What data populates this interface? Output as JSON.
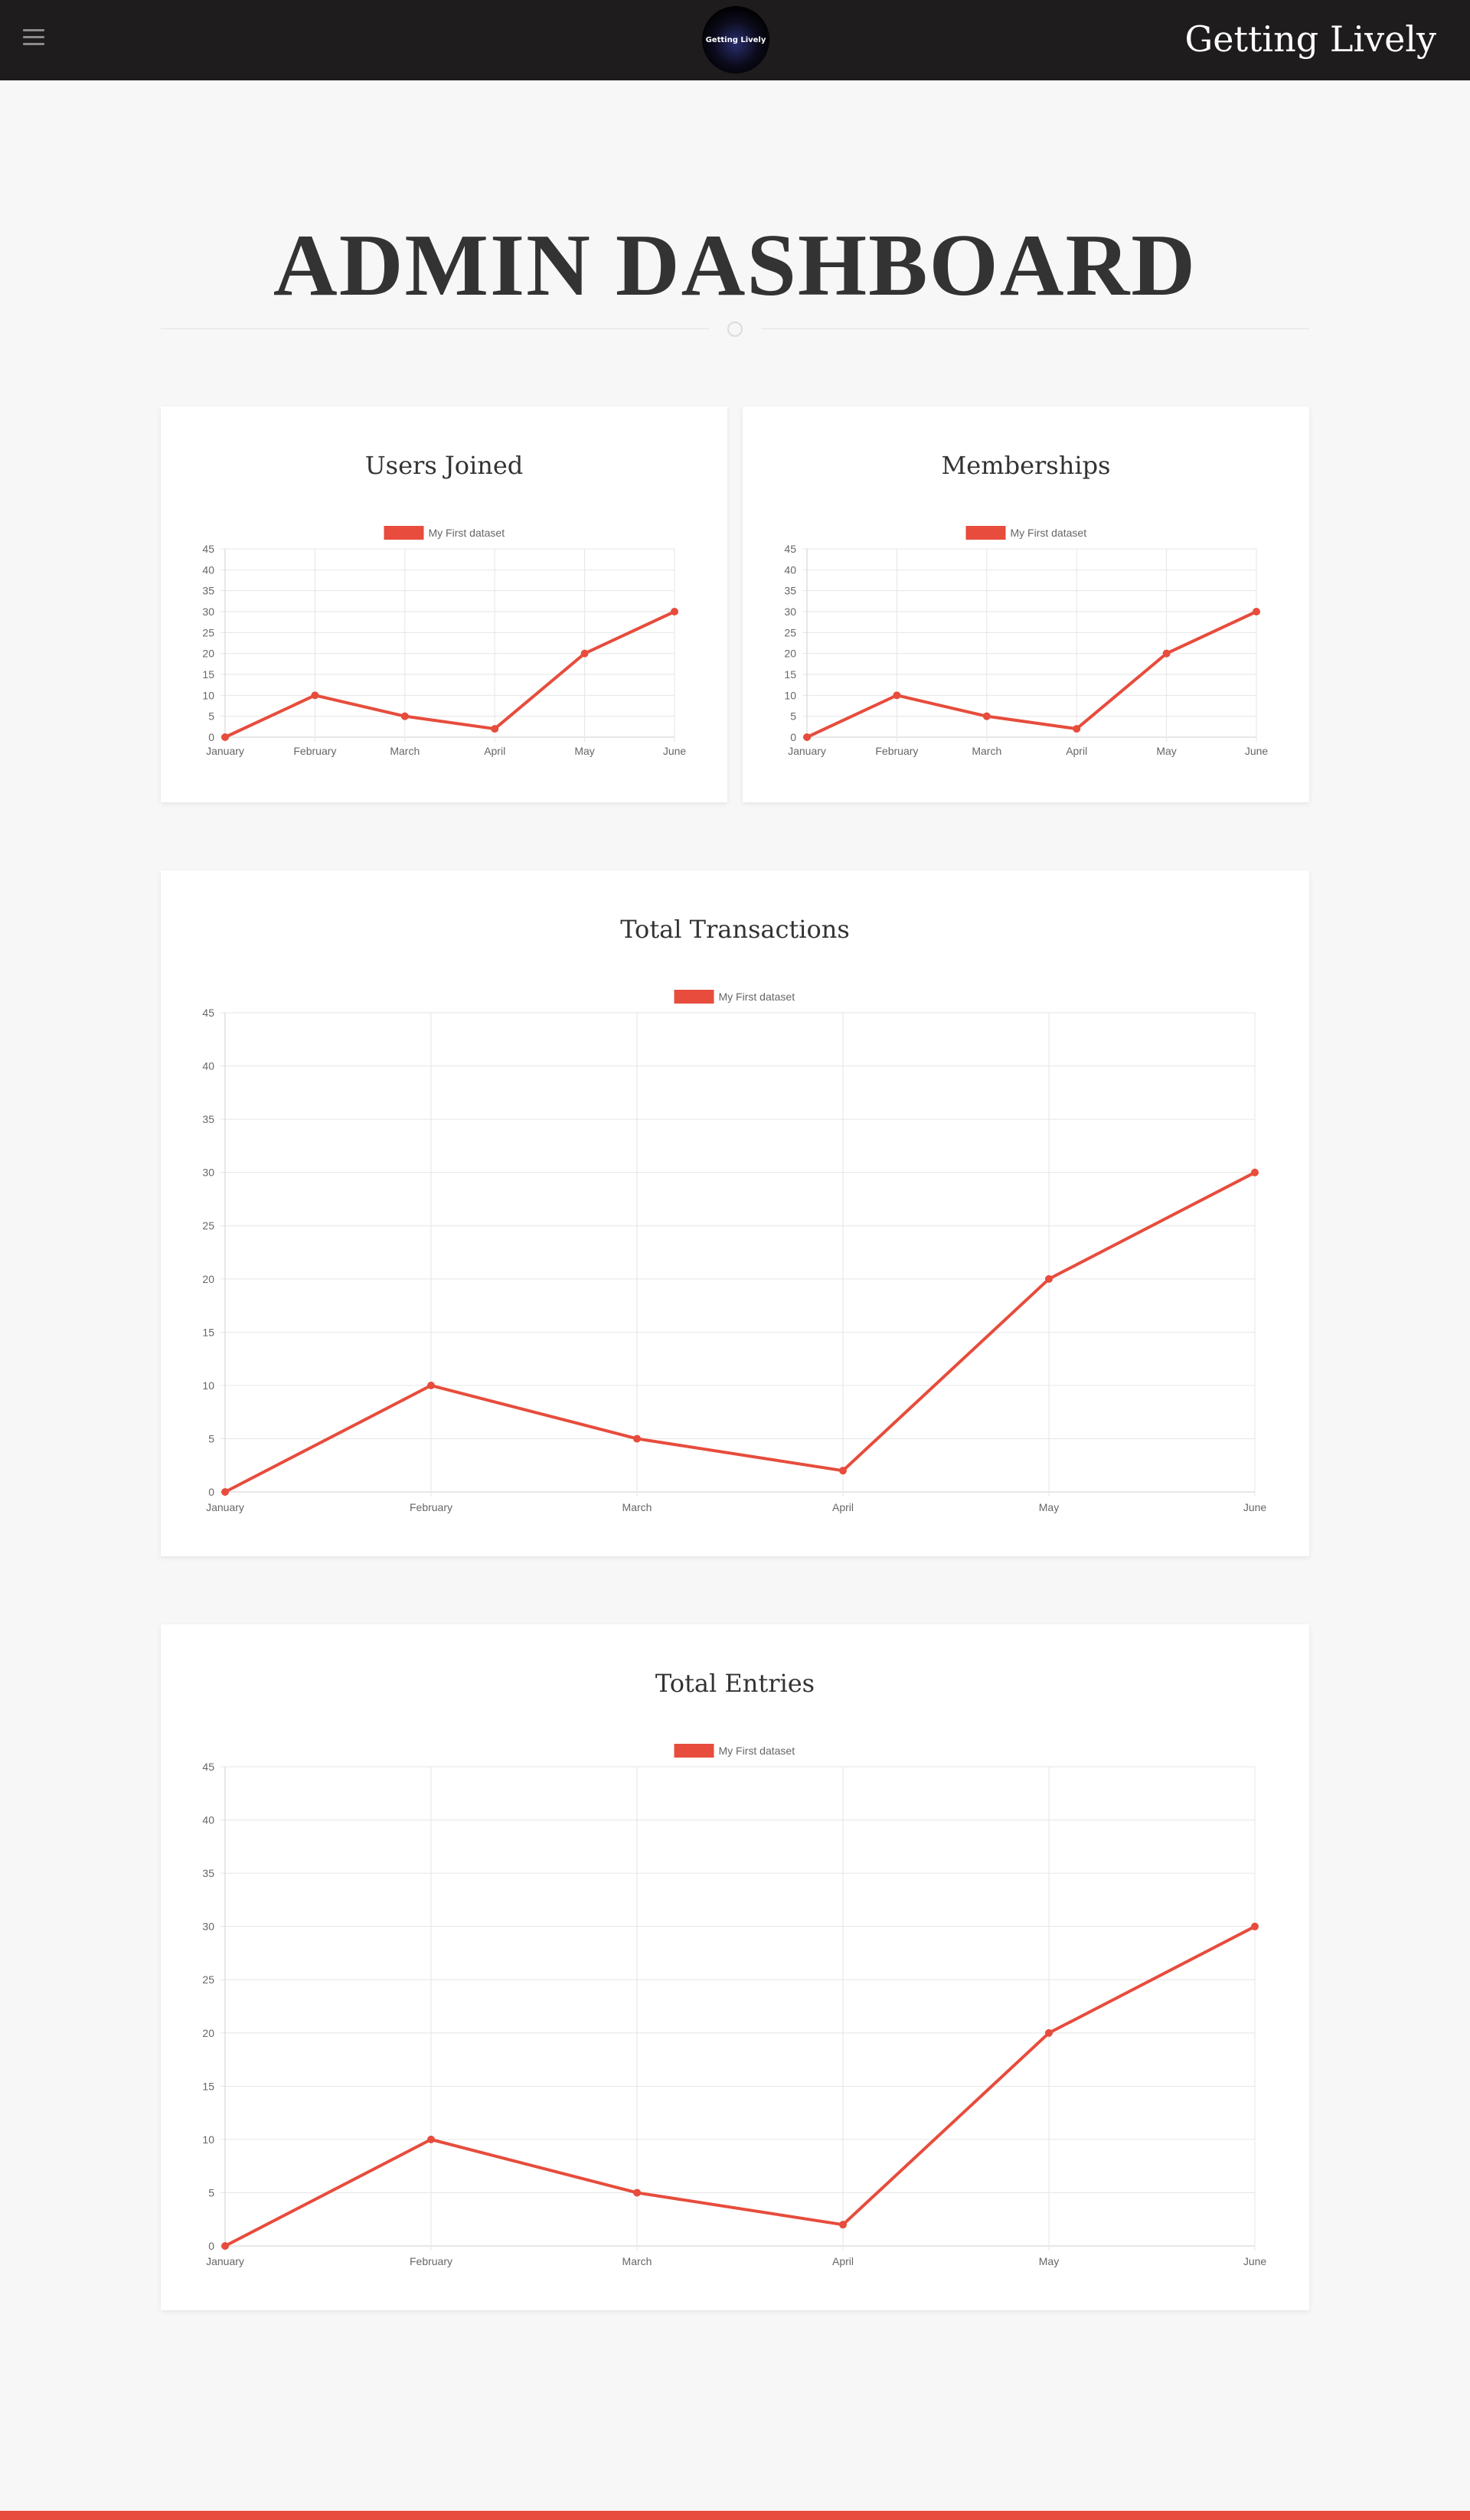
{
  "header": {
    "menu_icon": "hamburger-icon",
    "logo_text": "Getting Lively",
    "brand": "Getting Lively"
  },
  "page": {
    "title": "ADMIN DASHBOARD"
  },
  "colors": {
    "accent": "#e74c3c",
    "header_bg": "#1e1c1d",
    "text": "#333333"
  },
  "cards": [
    {
      "title": "Users Joined"
    },
    {
      "title": "Memberships"
    },
    {
      "title": "Total Transactions"
    },
    {
      "title": "Total Entries"
    }
  ],
  "chart_data": [
    {
      "type": "line",
      "title": "Users Joined",
      "categories": [
        "January",
        "February",
        "March",
        "April",
        "May",
        "June"
      ],
      "series": [
        {
          "name": "My First dataset",
          "values": [
            0,
            10,
            5,
            2,
            20,
            30
          ]
        }
      ],
      "yticks": [
        0,
        5,
        10,
        15,
        20,
        25,
        30,
        35,
        40,
        45
      ],
      "ylim": [
        0,
        45
      ],
      "grid": true,
      "legend": "top-center"
    },
    {
      "type": "line",
      "title": "Memberships",
      "categories": [
        "January",
        "February",
        "March",
        "April",
        "May",
        "June"
      ],
      "series": [
        {
          "name": "My First dataset",
          "values": [
            0,
            10,
            5,
            2,
            20,
            30
          ]
        }
      ],
      "yticks": [
        0,
        5,
        10,
        15,
        20,
        25,
        30,
        35,
        40,
        45
      ],
      "ylim": [
        0,
        45
      ],
      "grid": true,
      "legend": "top-center"
    },
    {
      "type": "line",
      "title": "Total Transactions",
      "categories": [
        "January",
        "February",
        "March",
        "April",
        "May",
        "June"
      ],
      "series": [
        {
          "name": "My First dataset",
          "values": [
            0,
            10,
            5,
            2,
            20,
            30
          ]
        }
      ],
      "yticks": [
        0,
        5,
        10,
        15,
        20,
        25,
        30,
        35,
        40,
        45
      ],
      "ylim": [
        0,
        45
      ],
      "grid": true,
      "legend": "top-center"
    },
    {
      "type": "line",
      "title": "Total Entries",
      "categories": [
        "January",
        "February",
        "March",
        "April",
        "May",
        "June"
      ],
      "series": [
        {
          "name": "My First dataset",
          "values": [
            0,
            10,
            5,
            2,
            20,
            30
          ]
        }
      ],
      "yticks": [
        0,
        5,
        10,
        15,
        20,
        25,
        30,
        35,
        40,
        45
      ],
      "ylim": [
        0,
        45
      ],
      "grid": true,
      "legend": "top-center"
    }
  ]
}
